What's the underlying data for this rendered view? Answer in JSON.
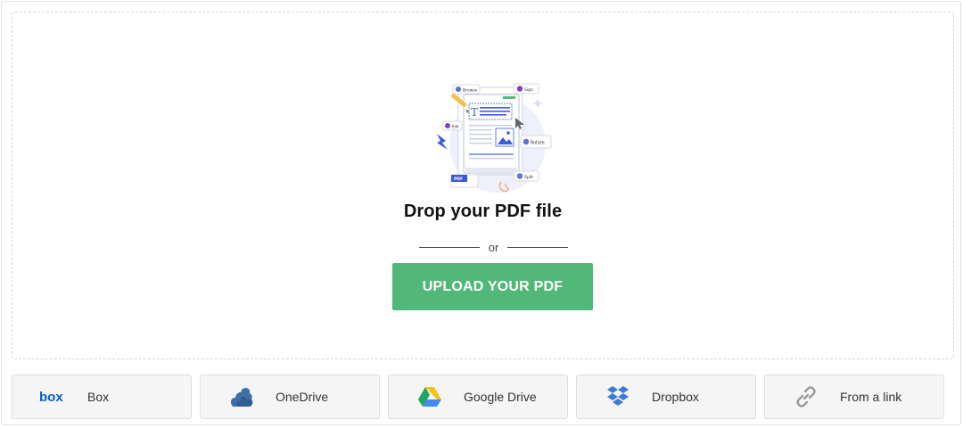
{
  "dropzone": {
    "title": "Drop your PDF file",
    "or_text": "or",
    "upload_label": "UPLOAD YOUR PDF"
  },
  "illustration": {
    "tag_browse": "Browse",
    "tag_sign": "Sign",
    "tag_rotate": "Rotate",
    "tag_split": "Split",
    "tag_edit": "Edit",
    "tag_pdf": "PDF",
    "text_tool": "T"
  },
  "sources": [
    {
      "label": "Box",
      "icon": "box-logo-icon"
    },
    {
      "label": "OneDrive",
      "icon": "onedrive-icon"
    },
    {
      "label": "Google Drive",
      "icon": "google-drive-icon"
    },
    {
      "label": "Dropbox",
      "icon": "dropbox-icon"
    },
    {
      "label": "From a link",
      "icon": "link-icon"
    }
  ],
  "box_logo_text": "box",
  "colors": {
    "upload_button": "#52b87a",
    "box_blue": "#0061d5",
    "onedrive_blue": "#3d6fa6",
    "dropbox_blue": "#3d7ad6",
    "link_gray": "#9a9a9a"
  }
}
